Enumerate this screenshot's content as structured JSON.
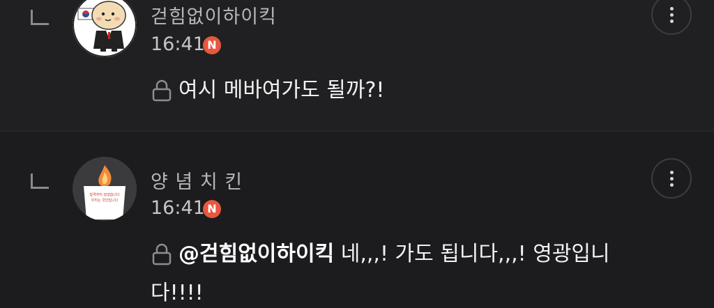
{
  "comments": [
    {
      "username": "걷힘없이하이킥",
      "time": "16:41",
      "badge": "N",
      "text": "여시 메바여가도 될까?!"
    },
    {
      "username": "양 념 치 킨",
      "time": "16:41",
      "badge": "N",
      "mention": "@걷힘없이하이킥",
      "text_line1": " 네,,,! 가도 됩니다,,,! 영광입니",
      "text_line2": "다!!!!",
      "avatar_sign_line1": "합격하지 않겠습니다",
      "avatar_sign_line2": "우리는 국민입니다"
    }
  ],
  "colors": {
    "background": "#1c1c1e",
    "badge": "#e9573f"
  },
  "icons": [
    "reply-arrow-icon",
    "lock-icon",
    "more-vertical-icon",
    "new-badge-icon"
  ]
}
